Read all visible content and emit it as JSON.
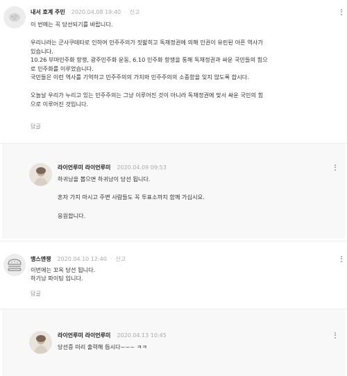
{
  "comments": [
    {
      "author": "내서 호계 주민",
      "date": "2020.04.08 19:40",
      "separator": "·",
      "report": "신고",
      "lines": [
        "이 번에는 꼭 당선되기를 바랍니다.",
        "",
        "우리나라는 군사쿠테타로 인하여 민주주의가 짓밟히고 독재정권에 의해 인권이 유린된 아픈 역사가",
        "있습니다.",
        "10.26 부마민주화 항쟁, 광주민주화 운동, 6.10 민주화 항쟁을 통해 독재정권과 싸운 국민들의 힘으",
        "로 민주화를 이루었습니다.",
        "국민들은 이런 역사를 기억하고 민주주의의 가치와 민주주의의 소중함을 잊지 않도록 합시다.",
        "",
        "오늘날 우리가 누리고 있는 민주주의는 그냥 이루어진 것이 아니라 독재정권에 맞서 싸운 국민의 힘",
        "으로 이루어진 것입니다."
      ],
      "reply_label": "답글"
    },
    {
      "author": "라이언루미 라이언루미",
      "date": "2020.04.09 09:53",
      "separator": "·",
      "lines": [
        "하귀남을 뽑으면 하귀남이 당선 됩니다.",
        "",
        "혼자 가지 마시고 주변 사람들도 꼭 투표소까지 함께 가십시요.",
        "",
        "응원합니다."
      ]
    },
    {
      "author": "맹스앤쟁",
      "date": "2020.04.10 12:40",
      "separator": "·",
      "report": "신고",
      "lines": [
        "이번에는 꼬옥 당선 됩니다.",
        "하기남 파이팅 입니다."
      ],
      "reply_label": "답글"
    },
    {
      "author": "라이언루미 라이언루미",
      "date": "2020.04.13 10:45",
      "separator": "·",
      "lines": [
        "당선증 미리 출력해 듭시다~~~ ㅋㅋ"
      ]
    }
  ],
  "icons": {
    "more": "more-vertical-icon",
    "burger_avatar": "burger-avatar-icon",
    "photo_avatar": "profile-photo-icon",
    "pattern_avatar": "pattern-avatar-icon"
  },
  "colors": {
    "reply_background": "#f8f8f8",
    "meta_gray": "#aaaaaa",
    "author": "#222222",
    "text": "#333333"
  }
}
